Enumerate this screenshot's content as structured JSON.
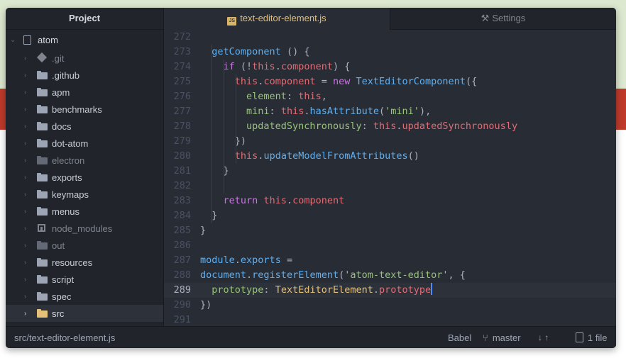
{
  "colors": {
    "background_top": "#dde8d0",
    "background_red": "#bf3a2b",
    "window_bg": "#282c34",
    "sidebar_bg": "#21252b",
    "accent_tab": "#e5c07b",
    "folder_selected": "#e5c07b",
    "keyword": "#c678dd",
    "this": "#e06c75",
    "function": "#61afef",
    "string": "#98c379",
    "class": "#e5c07b"
  },
  "sidebar": {
    "header": "Project",
    "root": {
      "label": "atom",
      "icon": "repo-icon"
    },
    "items": [
      {
        "label": ".git",
        "icon": "git-icon",
        "dim": true
      },
      {
        "label": ".github",
        "icon": "folder-icon",
        "dim": false
      },
      {
        "label": "apm",
        "icon": "folder-icon",
        "dim": false
      },
      {
        "label": "benchmarks",
        "icon": "folder-icon",
        "dim": false
      },
      {
        "label": "docs",
        "icon": "folder-icon",
        "dim": false
      },
      {
        "label": "dot-atom",
        "icon": "folder-icon",
        "dim": false
      },
      {
        "label": "electron",
        "icon": "folder-icon",
        "dim": true
      },
      {
        "label": "exports",
        "icon": "folder-icon",
        "dim": false
      },
      {
        "label": "keymaps",
        "icon": "folder-icon",
        "dim": false
      },
      {
        "label": "menus",
        "icon": "folder-icon",
        "dim": false
      },
      {
        "label": "node_modules",
        "icon": "module-icon",
        "dim": true
      },
      {
        "label": "out",
        "icon": "folder-icon",
        "dim": true
      },
      {
        "label": "resources",
        "icon": "folder-icon",
        "dim": false
      },
      {
        "label": "script",
        "icon": "folder-icon",
        "dim": false
      },
      {
        "label": "spec",
        "icon": "folder-icon",
        "dim": false
      },
      {
        "label": "src",
        "icon": "folder-icon",
        "dim": false,
        "selected": true
      }
    ]
  },
  "tabs": [
    {
      "label": "text-editor-element.js",
      "badge": "JS",
      "active": true,
      "icon": "js-file-icon"
    },
    {
      "label": "Settings",
      "active": false,
      "icon": "tools-icon"
    }
  ],
  "editor": {
    "cursor_line": 289,
    "lines": [
      {
        "n": "272",
        "tokens": []
      },
      {
        "n": "273",
        "tokens": [
          [
            "plain",
            "  "
          ],
          [
            "fn",
            "getComponent"
          ],
          [
            "plain",
            " () {"
          ]
        ]
      },
      {
        "n": "274",
        "tokens": [
          [
            "plain",
            "    "
          ],
          [
            "kw",
            "if"
          ],
          [
            "plain",
            " (!"
          ],
          [
            "this",
            "this"
          ],
          [
            "plain",
            "."
          ],
          [
            "this",
            "component"
          ],
          [
            "plain",
            ") {"
          ]
        ]
      },
      {
        "n": "275",
        "tokens": [
          [
            "plain",
            "      "
          ],
          [
            "this",
            "this"
          ],
          [
            "plain",
            "."
          ],
          [
            "this",
            "component"
          ],
          [
            "plain",
            " = "
          ],
          [
            "kw",
            "new"
          ],
          [
            "plain",
            " "
          ],
          [
            "fn",
            "TextEditorComponent"
          ],
          [
            "plain",
            "({"
          ]
        ]
      },
      {
        "n": "276",
        "tokens": [
          [
            "plain",
            "        "
          ],
          [
            "key",
            "element"
          ],
          [
            "plain",
            ": "
          ],
          [
            "this",
            "this"
          ],
          [
            "plain",
            ","
          ]
        ]
      },
      {
        "n": "277",
        "tokens": [
          [
            "plain",
            "        "
          ],
          [
            "key",
            "mini"
          ],
          [
            "plain",
            ": "
          ],
          [
            "this",
            "this"
          ],
          [
            "plain",
            "."
          ],
          [
            "fn",
            "hasAttribute"
          ],
          [
            "plain",
            "("
          ],
          [
            "str",
            "'mini'"
          ],
          [
            "plain",
            "),"
          ]
        ]
      },
      {
        "n": "278",
        "tokens": [
          [
            "plain",
            "        "
          ],
          [
            "key",
            "updatedSynchronously"
          ],
          [
            "plain",
            ": "
          ],
          [
            "this",
            "this"
          ],
          [
            "plain",
            "."
          ],
          [
            "this",
            "updatedSynchronously"
          ]
        ]
      },
      {
        "n": "279",
        "tokens": [
          [
            "plain",
            "      })"
          ]
        ]
      },
      {
        "n": "280",
        "tokens": [
          [
            "plain",
            "      "
          ],
          [
            "this",
            "this"
          ],
          [
            "plain",
            "."
          ],
          [
            "fn",
            "updateModelFromAttributes"
          ],
          [
            "plain",
            "()"
          ]
        ]
      },
      {
        "n": "281",
        "tokens": [
          [
            "plain",
            "    }"
          ]
        ]
      },
      {
        "n": "282",
        "tokens": []
      },
      {
        "n": "283",
        "tokens": [
          [
            "plain",
            "    "
          ],
          [
            "kw",
            "return"
          ],
          [
            "plain",
            " "
          ],
          [
            "this",
            "this"
          ],
          [
            "plain",
            "."
          ],
          [
            "this",
            "component"
          ]
        ]
      },
      {
        "n": "284",
        "tokens": [
          [
            "plain",
            "  }"
          ]
        ]
      },
      {
        "n": "285",
        "tokens": [
          [
            "plain",
            "}"
          ]
        ]
      },
      {
        "n": "286",
        "tokens": []
      },
      {
        "n": "287",
        "tokens": [
          [
            "fn",
            "module"
          ],
          [
            "plain",
            "."
          ],
          [
            "fn",
            "exports"
          ],
          [
            "plain",
            " ="
          ]
        ]
      },
      {
        "n": "288",
        "tokens": [
          [
            "fn",
            "document"
          ],
          [
            "plain",
            "."
          ],
          [
            "fn",
            "registerElement"
          ],
          [
            "plain",
            "("
          ],
          [
            "str",
            "'atom-text-editor'"
          ],
          [
            "plain",
            ", {"
          ]
        ]
      },
      {
        "n": "289",
        "tokens": [
          [
            "plain",
            "  "
          ],
          [
            "key",
            "prototype"
          ],
          [
            "plain",
            ": "
          ],
          [
            "cls",
            "TextEditorElement"
          ],
          [
            "plain",
            "."
          ],
          [
            "this",
            "prototype"
          ]
        ],
        "cursor": true
      },
      {
        "n": "290",
        "tokens": [
          [
            "plain",
            "})"
          ]
        ]
      },
      {
        "n": "291",
        "tokens": []
      }
    ]
  },
  "statusbar": {
    "path": "src/text-editor-element.js",
    "grammar": "Babel",
    "branch": "master",
    "arrows": "↓ ↑",
    "files": "1 file"
  }
}
